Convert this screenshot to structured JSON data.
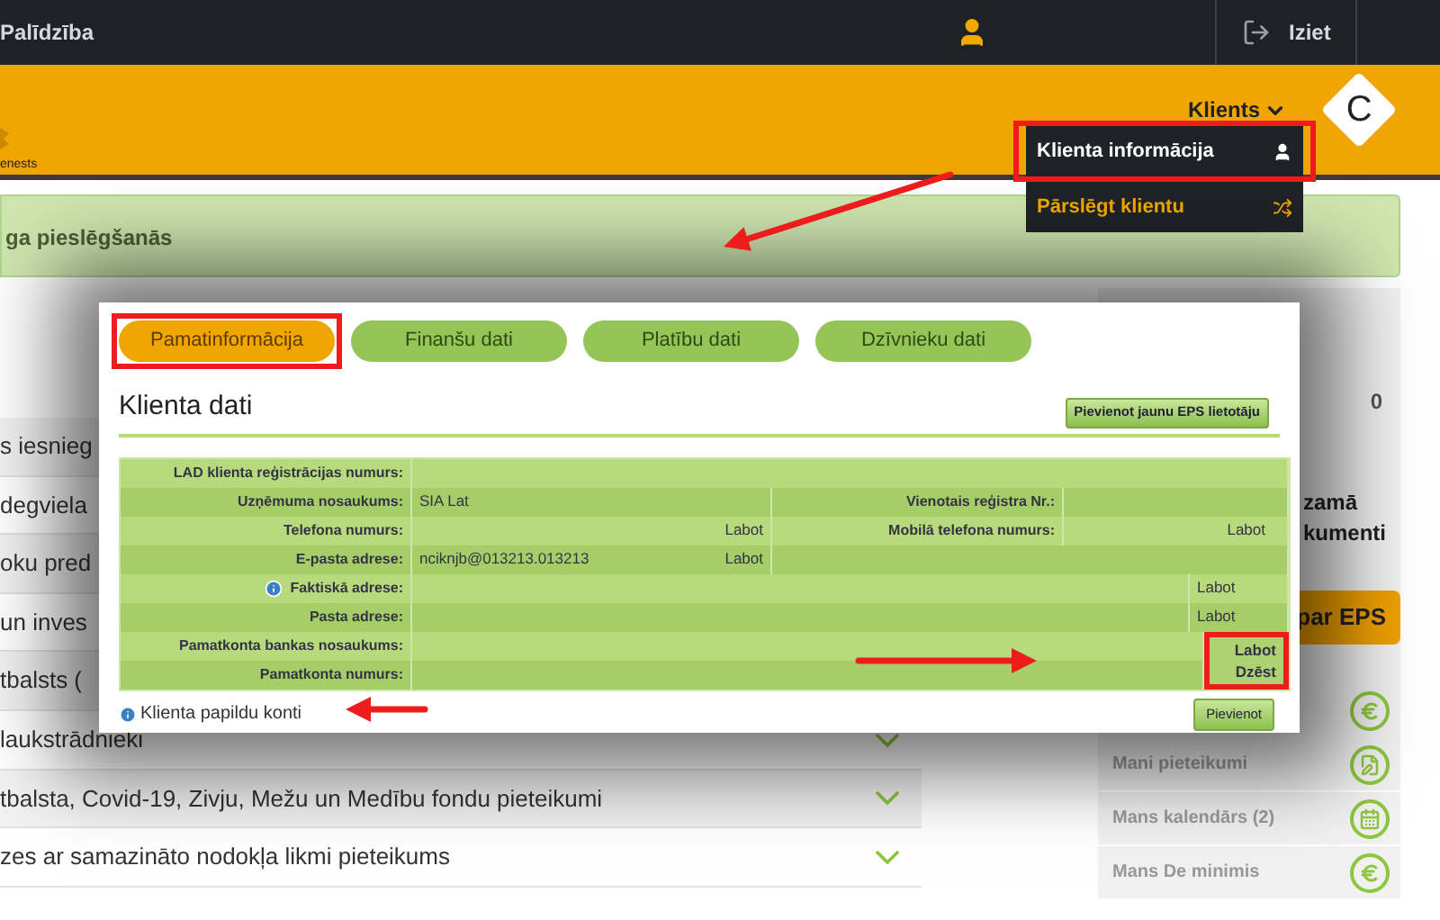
{
  "top_bar": {
    "help_link": "Palīdzība",
    "logout": "Iziet"
  },
  "header": {
    "logo_caption": "enests",
    "client_menu": {
      "label": "Klients",
      "expanded": true,
      "items": [
        {
          "label": "Klienta informācija",
          "kind": "info",
          "highlighted": true
        },
        {
          "label": "Pārslēgt klientu",
          "kind": "switch",
          "highlighted": false
        }
      ]
    },
    "avatar_letter": "C"
  },
  "alert": {
    "text": "ga pieslēgšanās"
  },
  "left_list": [
    {
      "text": "s iesnieg",
      "expandable": false
    },
    {
      "text": "degviela",
      "expandable": false
    },
    {
      "text": "oku pred",
      "expandable": false
    },
    {
      "text": "un inves",
      "expandable": false
    },
    {
      "text": "tbalsts (",
      "expandable": false
    },
    {
      "text": "laukstrādnieki",
      "expandable": true
    },
    {
      "text": "tbalsta, Covid-19, Zivju, Mežu un Medību fondu pieteikumi",
      "expandable": true
    },
    {
      "text": "zes ar samazināto nodokļa likmi pieteikums",
      "expandable": true
    }
  ],
  "right_panel": {
    "count": "0",
    "text": "zamā kumenti",
    "button": "par EPS",
    "links": [
      {
        "kind": "euro"
      },
      {
        "text": "Mani pieteikumi",
        "kind": "document"
      },
      {
        "text": "Mans kalendārs **(2)**",
        "kind": "calendar"
      },
      {
        "text": "Mans De minimis",
        "kind": "euro"
      }
    ]
  },
  "modal": {
    "tabs": [
      {
        "label": "Pamatinformācija",
        "selected": true,
        "highlighted": true
      },
      {
        "label": "Finanšu dati",
        "selected": false,
        "highlighted": false
      },
      {
        "label": "Platību dati",
        "selected": false,
        "highlighted": false
      },
      {
        "label": "Dzīvnieku dati",
        "selected": false,
        "highlighted": false
      }
    ],
    "title": "Klienta dati",
    "add_user_button": "Pievienot jaunu EPS lietotāju",
    "rows": [
      {
        "kind": "wide",
        "label": "LAD klienta reģistrācijas numurs:"
      },
      {
        "kind": "pair",
        "label": "Uzņēmuma nosaukums:",
        "value": "SIA Lat",
        "label_2": "Vienotais reģistra Nr.:"
      },
      {
        "kind": "pair",
        "label": "Telefona numurs:",
        "action": "Labot",
        "label_2": "Mobilā telefona numurs:",
        "action_2": "Labot"
      },
      {
        "kind": "single",
        "label": "E-pasta adrese:",
        "value": "nciknjb@013213.013213",
        "action": "Labot"
      },
      {
        "kind": "address",
        "label": "Faktiskā adrese:",
        "info": true,
        "action": "Labot"
      },
      {
        "kind": "address",
        "label": "Pasta adrese:",
        "info": false,
        "action": "Labot"
      }
    ],
    "account_rows": [
      {
        "label": "Pamatkonta bankas nosaukums:"
      },
      {
        "label": "Pamatkonta numurs:"
      }
    ],
    "account_actions": {
      "items": [
        "Labot",
        "Dzēst"
      ],
      "highlighted": true
    },
    "footer_link": "Klienta papildu konti",
    "add_button": "Pievienot"
  }
}
